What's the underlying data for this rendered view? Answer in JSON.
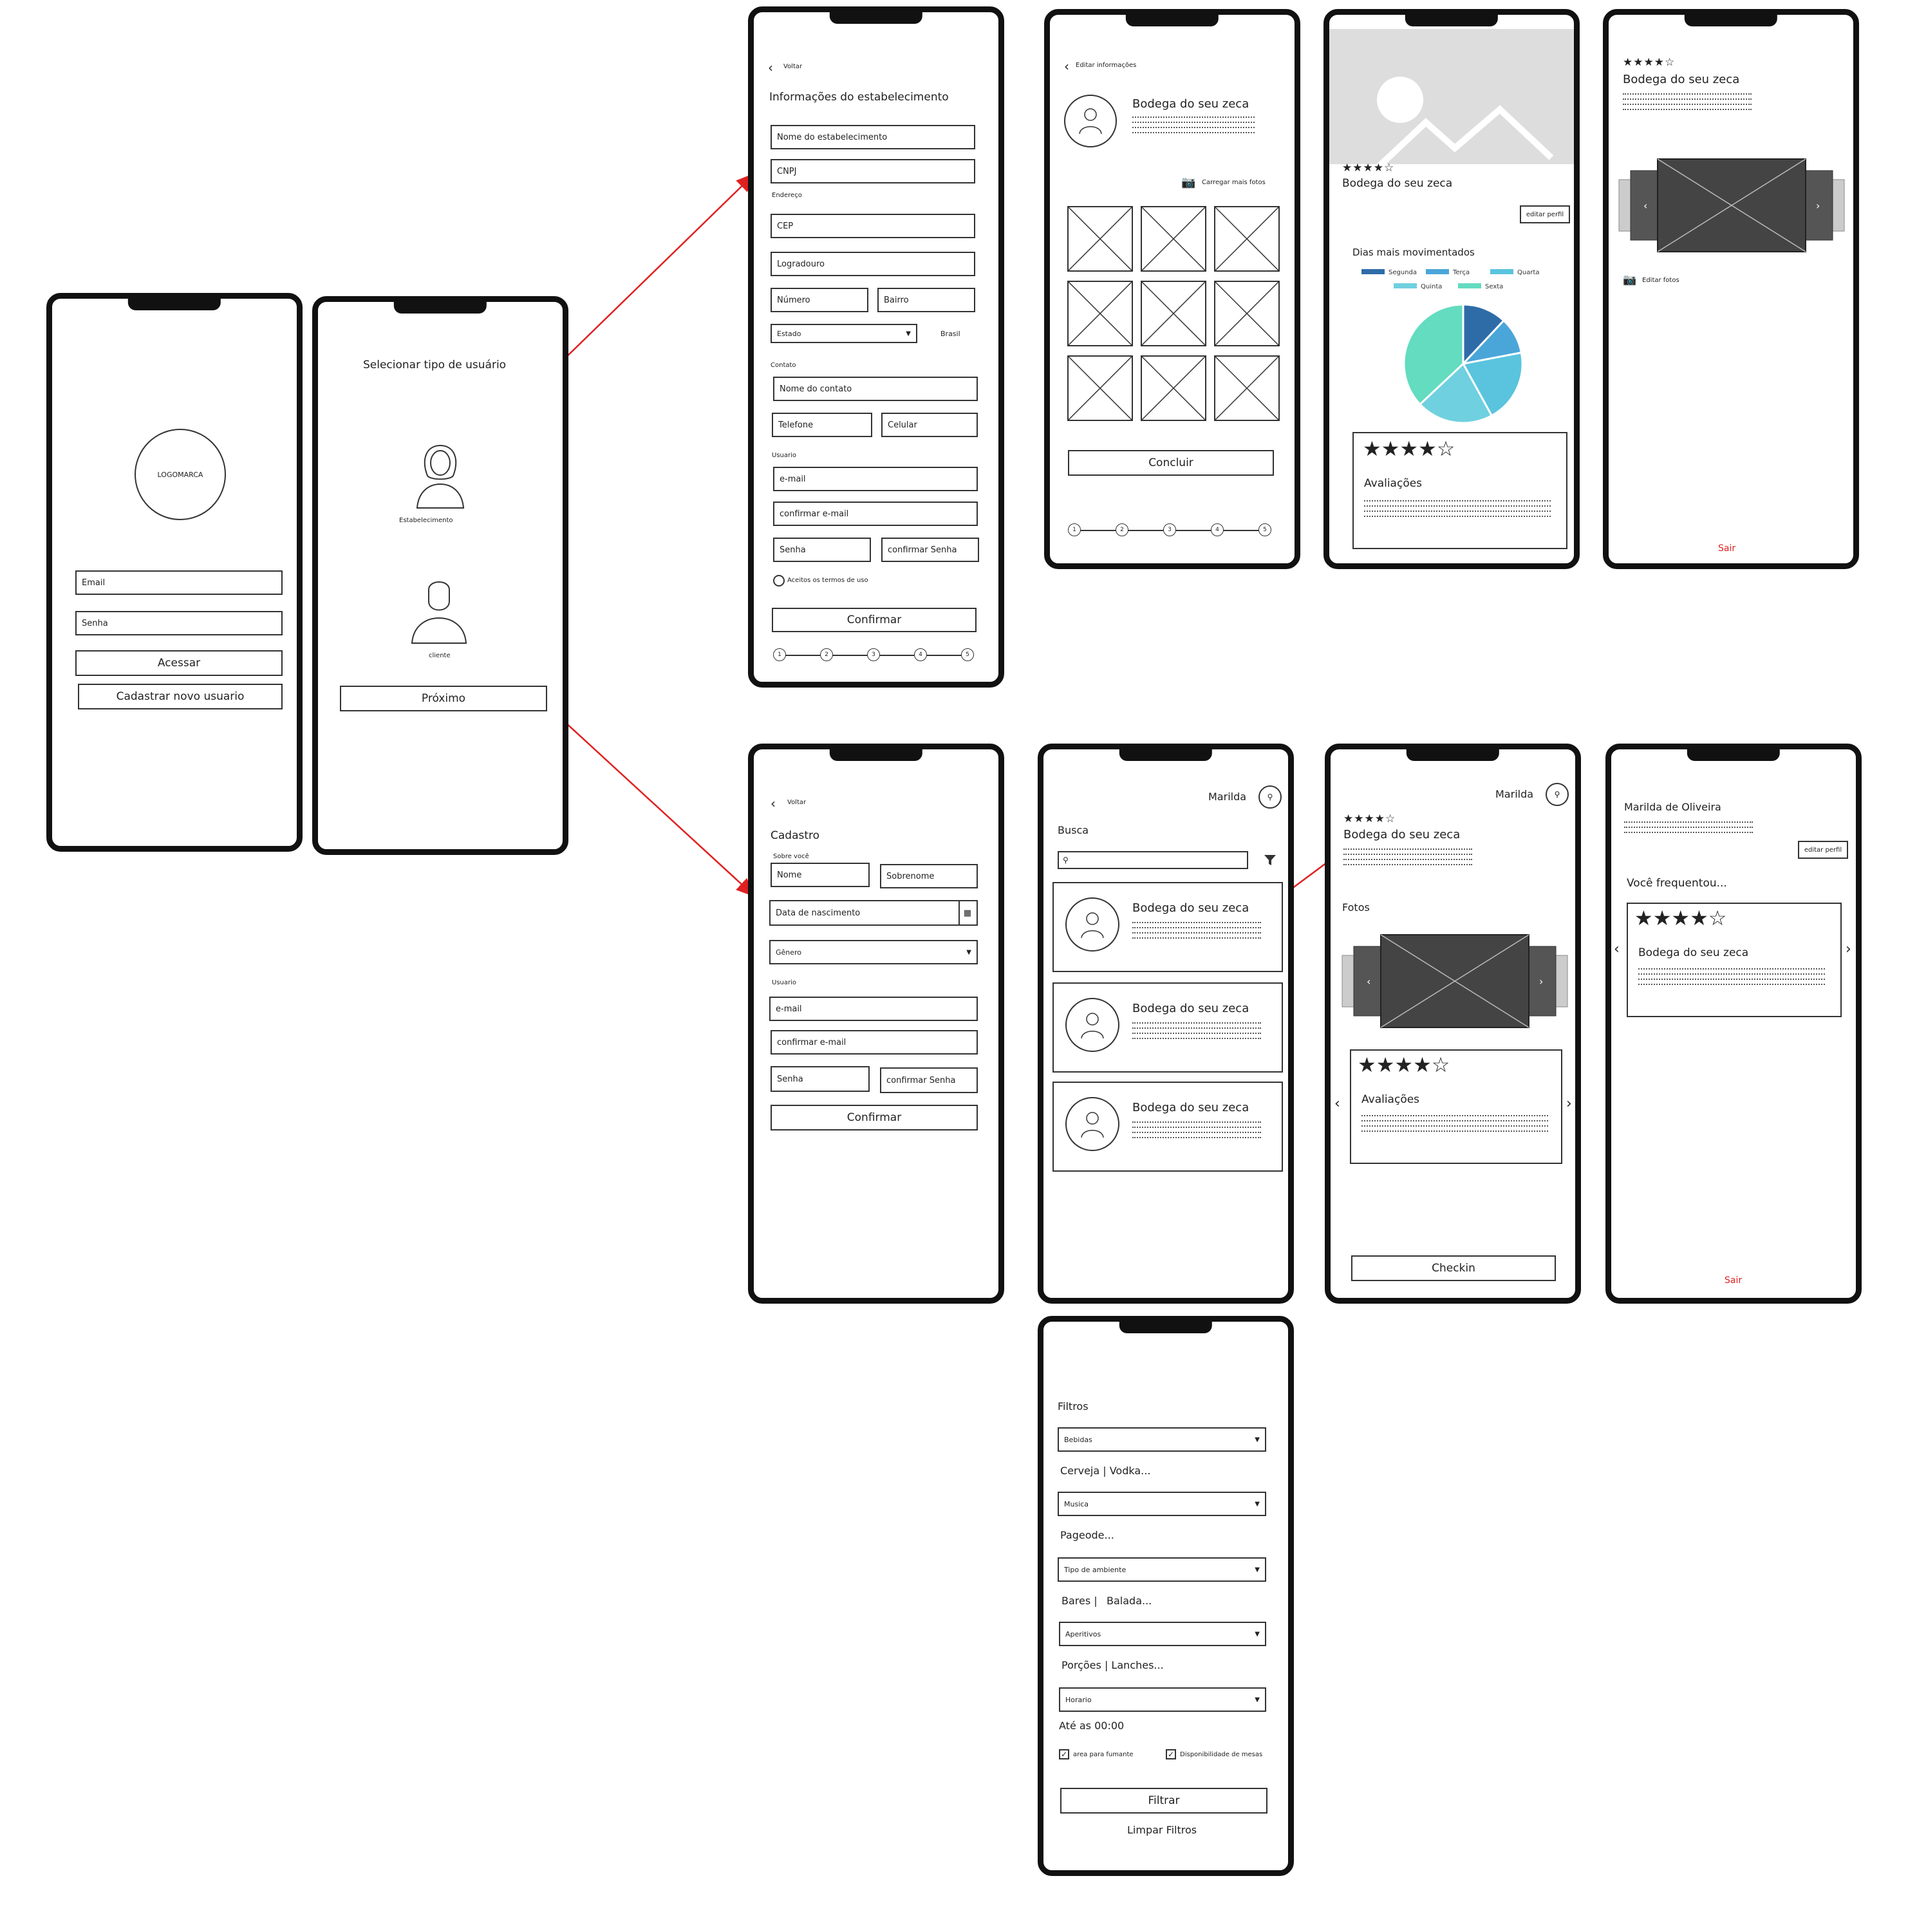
{
  "login": {
    "logo": "LOGOMARCA",
    "email_label": "Email",
    "password_label": "Senha",
    "access_button": "Acessar",
    "register_button": "Cadastrar novo usuario"
  },
  "user_type": {
    "title": "Selecionar tipo de usuário",
    "establishment_label": "Estabelecimento",
    "client_label": "cliente",
    "next_button": "Próximo"
  },
  "est_info": {
    "back": "Voltar",
    "title": "Informações do estabelecimento",
    "name_field": "Nome do estabelecimento",
    "cnpj_field": "CNPJ",
    "address_section": "Endereço",
    "cep_field": "CEP",
    "street_field": "Logradouro",
    "number_field": "Número",
    "district_field": "Bairro",
    "state_select": "Estado",
    "country": "Brasil",
    "contact_section": "Contato",
    "contact_name_field": "Nome do contato",
    "phone_field": "Telefone",
    "cell_field": "Celular",
    "user_section": "Usuario",
    "email_field": "e-mail",
    "confirm_email_field": "confirmar e-mail",
    "password_field": "Senha",
    "confirm_password_field": "confirmar Senha",
    "terms": "Aceitos os termos de uso",
    "confirm_button": "Confirmar",
    "steps": [
      "1",
      "2",
      "3",
      "4",
      "5"
    ]
  },
  "edit_info": {
    "back": "Editar informações",
    "place_name": "Bodega do seu zeca",
    "upload_photos": "Carregar mais fotos",
    "finish_button": "Concluir",
    "steps": [
      "1",
      "2",
      "3",
      "4",
      "5"
    ]
  },
  "est_profile": {
    "place_name": "Bodega do seu zeca",
    "edit_profile_button": "editar perfil",
    "chart_title": "Dias mais movimentados",
    "reviews_title": "Avaliações",
    "rating": 4,
    "max_rating": 5,
    "legend_colors": {
      "Segunda": "#2e6ca8",
      "Terça": "#4aa6d9",
      "Quarta": "#5ac4de",
      "Quinta": "#6fd0df",
      "Sexta": "#63dcc0"
    }
  },
  "chart_data": {
    "type": "pie",
    "title": "Dias mais movimentados",
    "categories": [
      "Segunda",
      "Terça",
      "Quarta",
      "Quinta",
      "Sexta"
    ],
    "values": [
      12,
      10,
      20,
      21,
      37
    ]
  },
  "est_photos": {
    "place_name": "Bodega do seu zeca",
    "edit_photos": "Editar fotos",
    "logout": "Sair"
  },
  "register": {
    "back": "Voltar",
    "title": "Cadastro",
    "about_section": "Sobre você",
    "first_name_field": "Nome",
    "last_name_field": "Sobrenome",
    "birth_field": "Data de nascimento",
    "gender_select": "Gênero",
    "user_section": "Usuario",
    "email_field": "e-mail",
    "confirm_email_field": "confirmar e-mail",
    "password_field": "Senha",
    "confirm_password_field": "confirmar Senha",
    "confirm_button": "Confirmar"
  },
  "search": {
    "user_name": "Marilda",
    "title": "Busca",
    "results": [
      {
        "name": "Bodega do seu zeca"
      },
      {
        "name": "Bodega do seu zeca"
      },
      {
        "name": "Bodega do seu zeca"
      }
    ]
  },
  "place_detail": {
    "user_name": "Marilda",
    "place_name": "Bodega do seu zeca",
    "photos_title": "Fotos",
    "reviews_title": "Avaliações",
    "checkin_button": "Checkin"
  },
  "client_profile": {
    "name": "Marilda de Oliveira",
    "edit_profile_button": "editar perfil",
    "visited_title": "Você frequentou...",
    "place_name": "Bodega do seu zeca",
    "logout": "Sair"
  },
  "filters": {
    "title": "Filtros",
    "drink_select": "Bebidas",
    "drink_hint": "Cerveja | Vodka...",
    "music_select": "Musica",
    "music_hint": "Pageode...",
    "ambience_select": "Tipo de ambiente",
    "ambience_hint_1": "Bares |",
    "ambience_hint_2": "Balada...",
    "appetizer_select": "Aperitivos",
    "appetizer_hint": "Porções | Lanches...",
    "hours_select": "Horario",
    "hours_hint": "Até as 00:00",
    "smoking_check": "area para fumante",
    "tables_check": "Disponibilidade de mesas",
    "filter_button": "Filtrar",
    "clear_button": "Limpar Filtros"
  }
}
